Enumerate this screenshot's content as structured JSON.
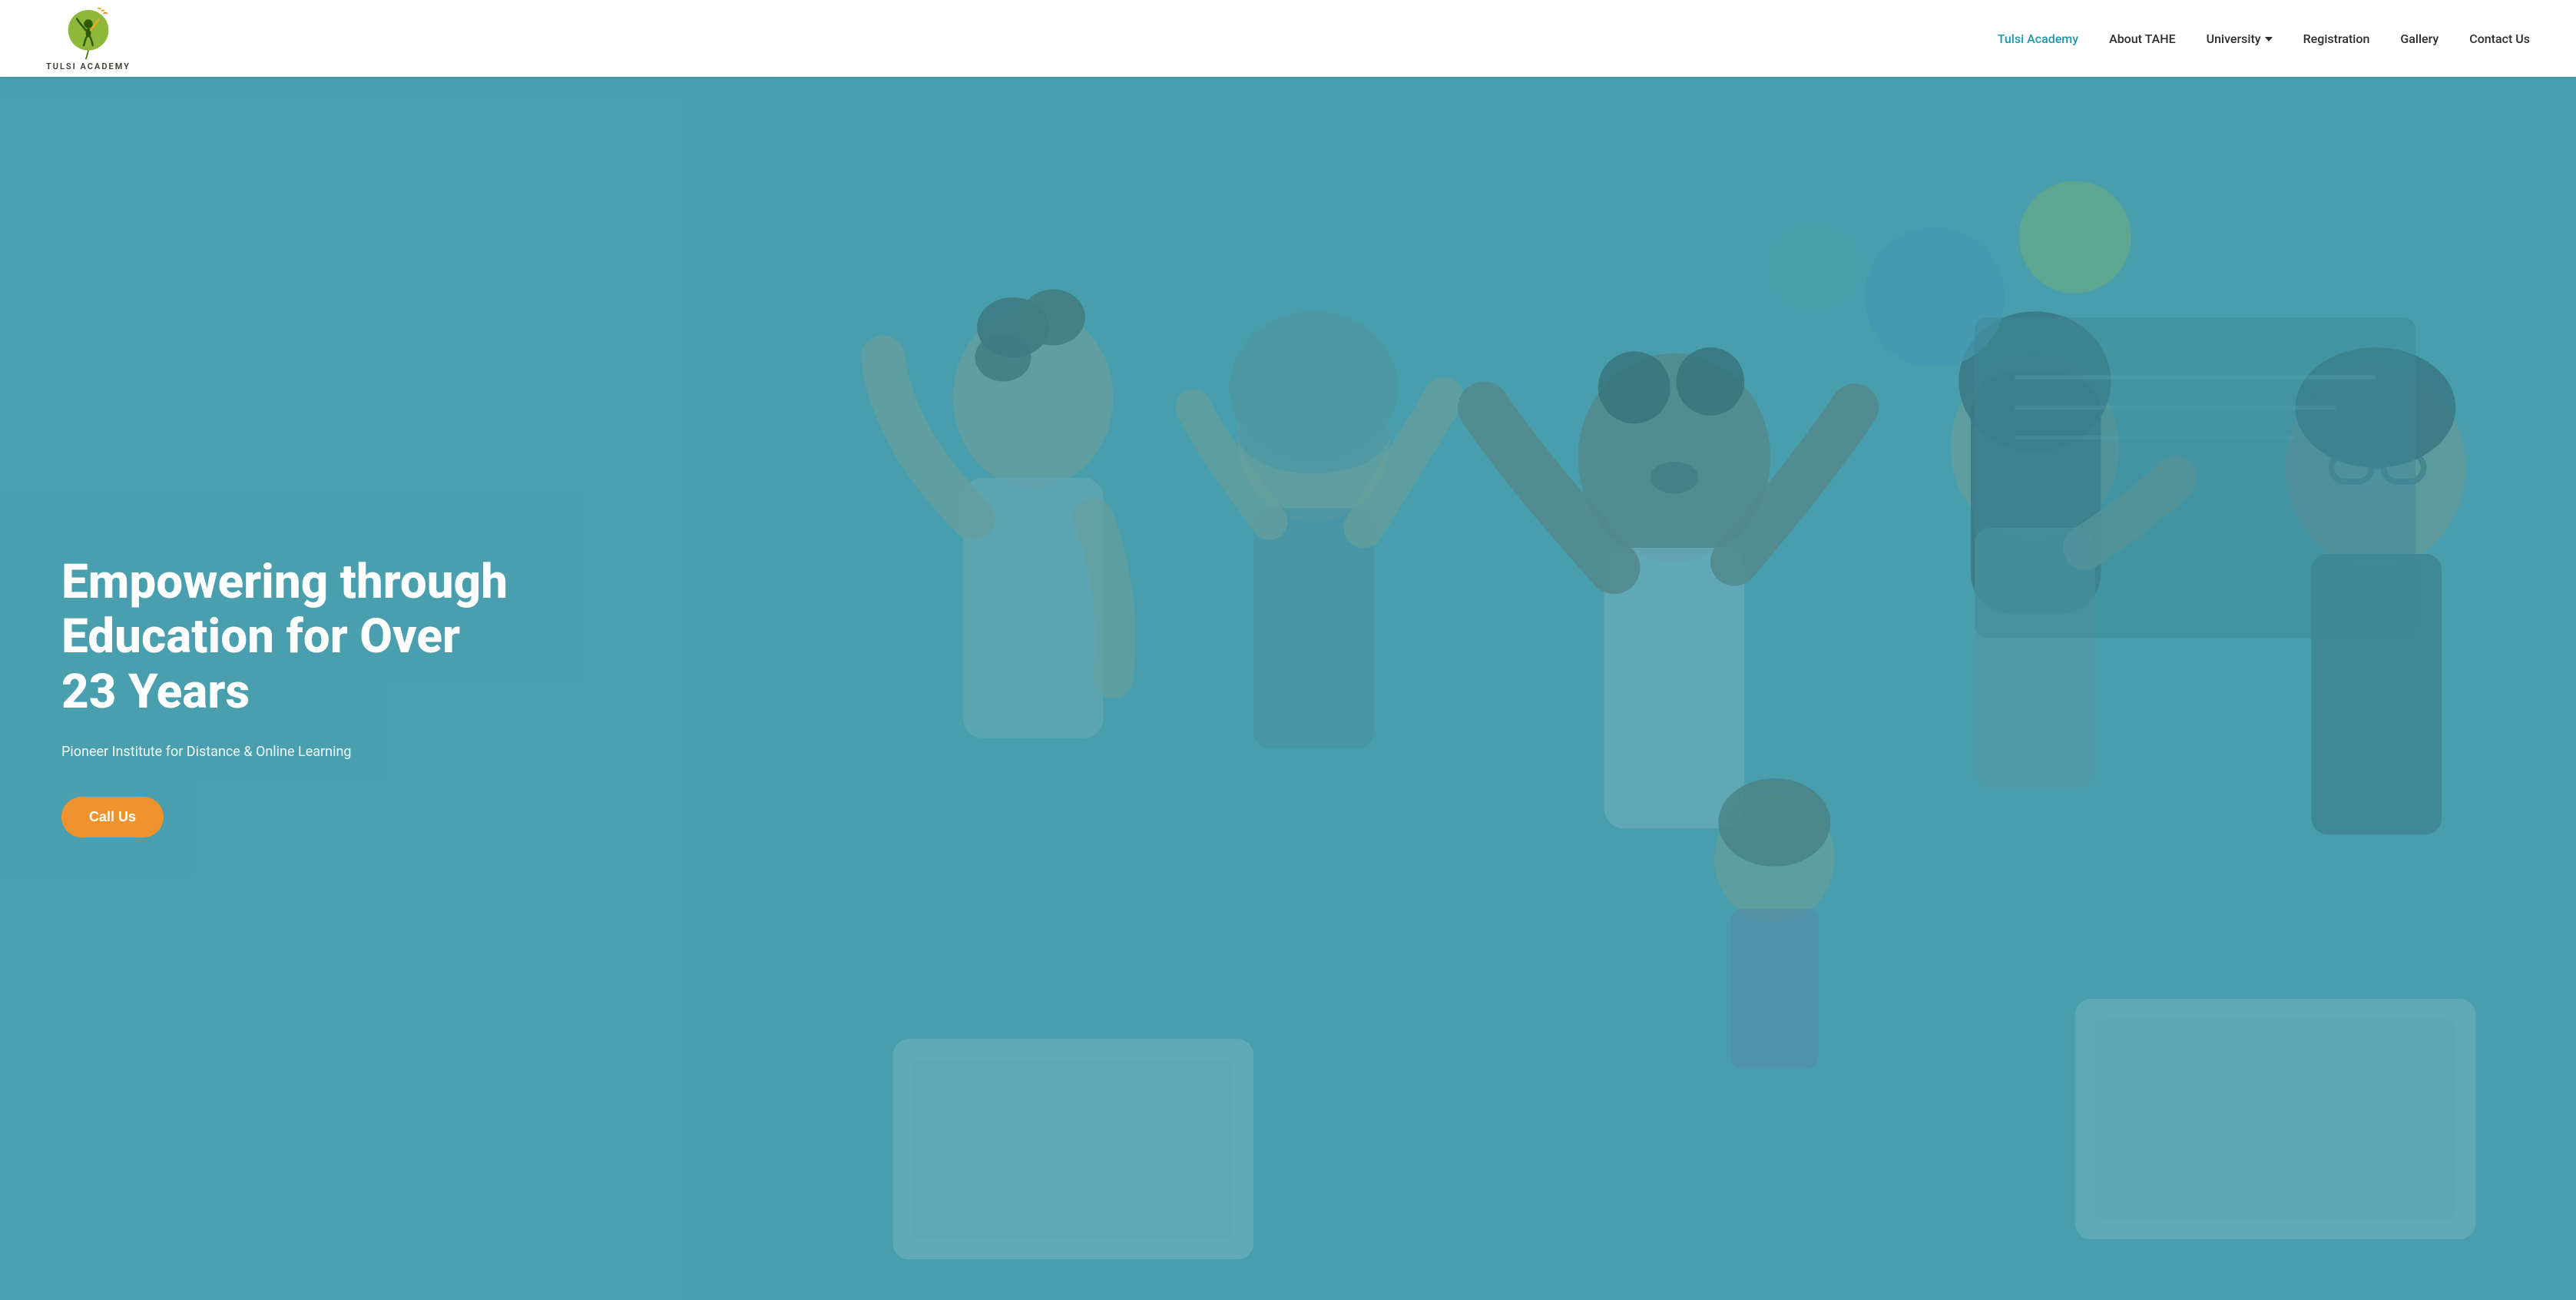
{
  "navbar": {
    "logo_text": "TULSI ACADEMY",
    "nav_items": [
      {
        "id": "tulsi-academy",
        "label": "Tulsi Academy",
        "active": true,
        "has_arrow": false
      },
      {
        "id": "about-tahe",
        "label": "About TAHE",
        "active": false,
        "has_arrow": false
      },
      {
        "id": "university",
        "label": "University",
        "active": false,
        "has_arrow": true
      },
      {
        "id": "registration",
        "label": "Registration",
        "active": false,
        "has_arrow": false
      },
      {
        "id": "gallery",
        "label": "Gallery",
        "active": false,
        "has_arrow": false
      },
      {
        "id": "contact-us",
        "label": "Contact Us",
        "active": false,
        "has_arrow": false
      }
    ]
  },
  "hero": {
    "title": "Empowering through Education for Over 23 Years",
    "subtitle": "Pioneer Institute for Distance & Online Learning",
    "cta_label": "Call Us",
    "bg_color": "#5aacb8",
    "overlay_color": "rgba(60,150,165,0.55)",
    "cta_color": "#f0922d"
  }
}
